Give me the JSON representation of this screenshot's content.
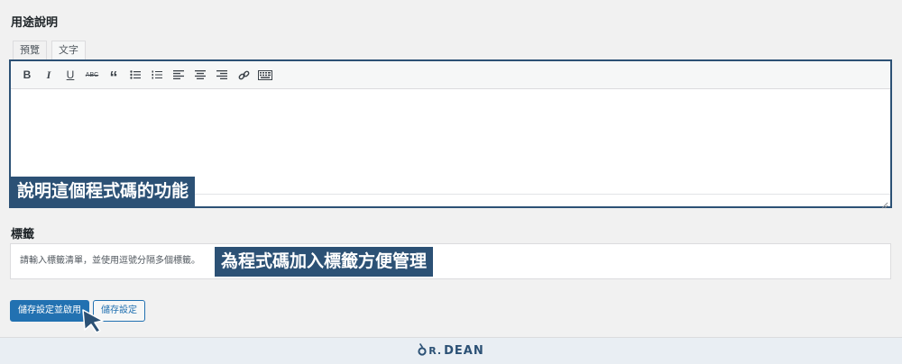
{
  "description_section": {
    "title": "用途說明",
    "tabs": [
      {
        "label": "預覽"
      },
      {
        "label": "文字"
      }
    ],
    "toolbar_icons": [
      "bold-icon",
      "italic-icon",
      "underline-icon",
      "strikethrough-icon",
      "blockquote-icon",
      "bullet-list-icon",
      "numbered-list-icon",
      "align-left-icon",
      "align-center-icon",
      "align-right-icon",
      "link-icon",
      "keyboard-icon"
    ],
    "toolbar_text": {
      "bold": "B",
      "italic": "I",
      "underline": "U",
      "strike": "ABC",
      "quote": "“"
    },
    "callout": "說明這個程式碼的功能"
  },
  "tags_section": {
    "title": "標籤",
    "placeholder": "請輸入標籤清單，並使用逗號分隔多個標籤。",
    "callout": "為程式碼加入標籤方便管理"
  },
  "actions": {
    "save_activate_label": "儲存設定並啟用",
    "save_label": "儲存設定"
  },
  "footer": {
    "brand_prefix": "R.",
    "brand_name": "DEAN"
  },
  "colors": {
    "accent": "#2c5175",
    "primary_button": "#2271b1"
  }
}
